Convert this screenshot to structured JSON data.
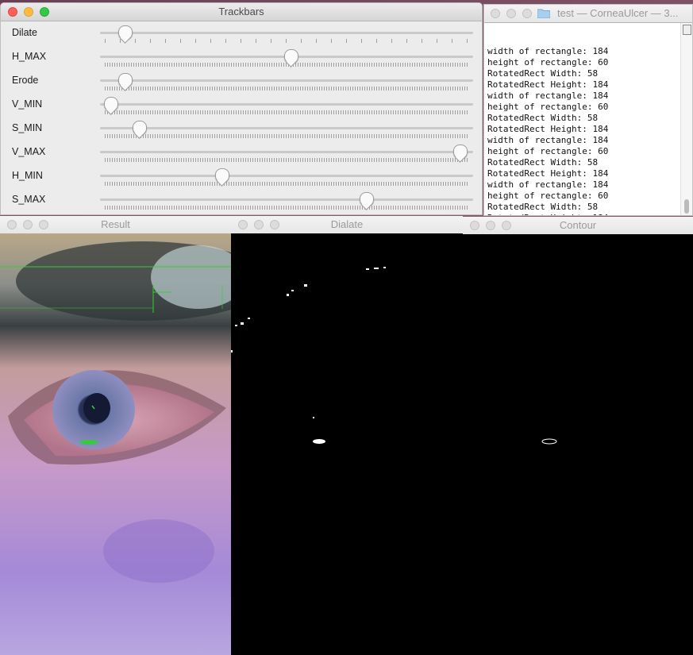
{
  "trackbars_window": {
    "title": "Trackbars",
    "sliders": [
      {
        "label": "Dilate",
        "value": 0.05
      },
      {
        "label": "H_MAX",
        "value": 0.51
      },
      {
        "label": "Erode",
        "value": 0.05
      },
      {
        "label": "V_MIN",
        "value": 0.01
      },
      {
        "label": "S_MIN",
        "value": 0.09
      },
      {
        "label": "V_MAX",
        "value": 0.98
      },
      {
        "label": "H_MIN",
        "value": 0.32
      },
      {
        "label": "S_MAX",
        "value": 0.72
      }
    ]
  },
  "terminal_window": {
    "title": "test — CorneaUlcer — 3...",
    "lines": [
      "width of rectangle: 184",
      "height of rectangle: 60",
      "RotatedRect Width: 58",
      "RotatedRect Height: 184",
      "width of rectangle: 184",
      "height of rectangle: 60",
      "RotatedRect Width: 58",
      "RotatedRect Height: 184",
      "width of rectangle: 184",
      "height of rectangle: 60",
      "RotatedRect Width: 58",
      "RotatedRect Height: 184",
      "width of rectangle: 184",
      "height of rectangle: 60",
      "RotatedRect Width: 58",
      "RotatedRect Height: 184"
    ]
  },
  "result_window": {
    "title": "Result"
  },
  "dialate_window": {
    "title": "Dialate"
  },
  "contour_window": {
    "title": "Contour"
  },
  "colors": {
    "detection_overlay": "#2bd42b",
    "mask_foreground": "#ffffff",
    "mask_background": "#000000"
  }
}
